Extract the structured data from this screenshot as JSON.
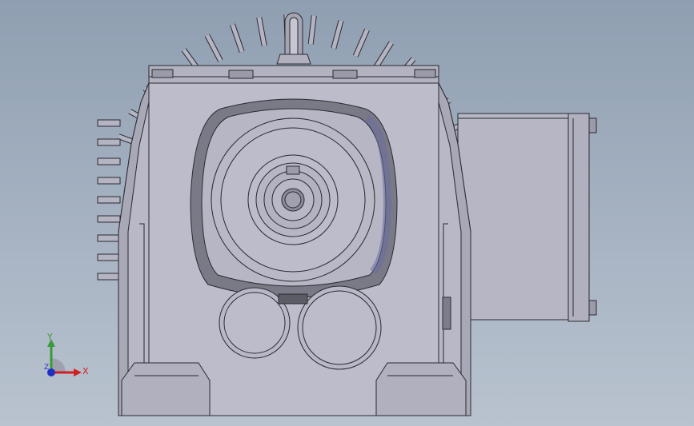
{
  "viewport": {
    "background_top": "#8f9fb1",
    "background_bottom": "#b9c3cf",
    "model_fill": "#b4b4c2",
    "model_shade": "#8c8c9c",
    "edge_color": "#2a2a32"
  },
  "triad": {
    "x_label": "X",
    "y_label": "Y",
    "z_label": "Z",
    "x_color": "#d02020",
    "y_color": "#3a9a3a",
    "z_color": "#2030c0"
  }
}
